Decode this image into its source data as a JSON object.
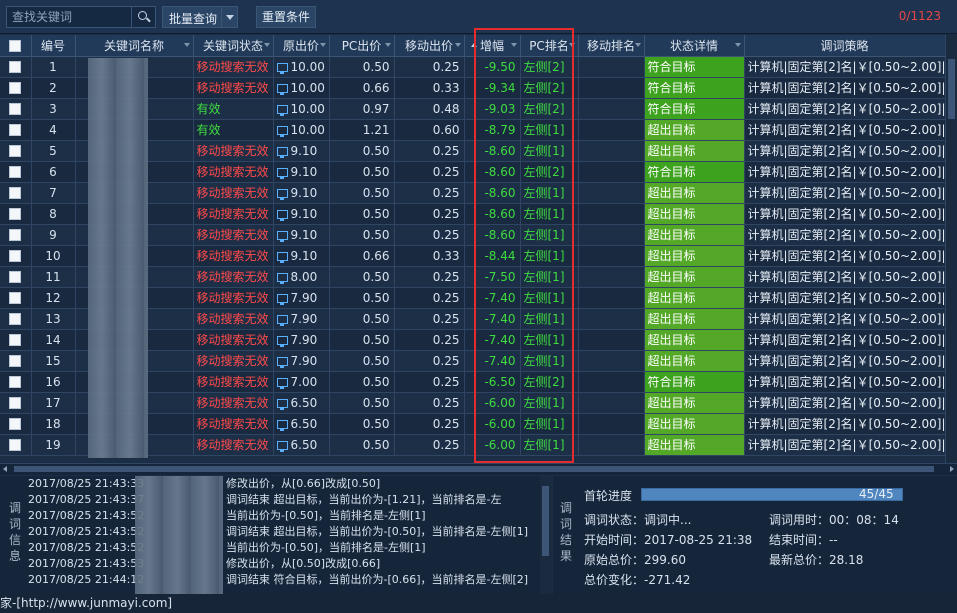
{
  "toolbar": {
    "search_placeholder": "查找关键词",
    "batch_label": "批量查询",
    "reset_label": "重置条件",
    "counter": "0/1123"
  },
  "table": {
    "headers": [
      "编号",
      "关键词名称",
      "关键词状态",
      "原出价",
      "PC出价",
      "移动出价",
      "增幅",
      "PC排名",
      "移动排名",
      "状态详情",
      "调词策略"
    ],
    "rows": [
      {
        "num": "1",
        "name": "",
        "status": "移动搜索无效",
        "orig": "10.00",
        "pc": "0.50",
        "mob": "0.25",
        "inc": "-9.50",
        "rank": "左侧[2]",
        "mrank": "",
        "detail": "符合目标",
        "strategy": "计算机|固定第[2]名|￥[0.50~2.00]|禧"
      },
      {
        "num": "2",
        "name": "",
        "status": "移动搜索无效",
        "orig": "10.00",
        "pc": "0.66",
        "mob": "0.33",
        "inc": "-9.34",
        "rank": "左侧[2]",
        "mrank": "",
        "detail": "符合目标",
        "strategy": "计算机|固定第[2]名|￥[0.50~2.00]|禧"
      },
      {
        "num": "3",
        "name": "",
        "status": "有效",
        "orig": "10.00",
        "pc": "0.97",
        "mob": "0.48",
        "inc": "-9.03",
        "rank": "左侧[2]",
        "mrank": "",
        "detail": "符合目标",
        "strategy": "计算机|固定第[2]名|￥[0.50~2.00]|禧"
      },
      {
        "num": "4",
        "name": "",
        "status": "有效",
        "orig": "10.00",
        "pc": "1.21",
        "mob": "0.60",
        "inc": "-8.79",
        "rank": "左侧[1]",
        "mrank": "",
        "detail": "超出目标",
        "strategy": "计算机|固定第[2]名|￥[0.50~2.00]|禧"
      },
      {
        "num": "5",
        "name": "",
        "status": "移动搜索无效",
        "orig": "9.10",
        "pc": "0.50",
        "mob": "0.25",
        "inc": "-8.60",
        "rank": "左侧[1]",
        "mrank": "",
        "detail": "超出目标",
        "strategy": "计算机|固定第[2]名|￥[0.50~2.00]|禧"
      },
      {
        "num": "6",
        "name": "",
        "status": "移动搜索无效",
        "orig": "9.10",
        "pc": "0.50",
        "mob": "0.25",
        "inc": "-8.60",
        "rank": "左侧[2]",
        "mrank": "",
        "detail": "符合目标",
        "strategy": "计算机|固定第[2]名|￥[0.50~2.00]|禧"
      },
      {
        "num": "7",
        "name": "",
        "status": "移动搜索无效",
        "orig": "9.10",
        "pc": "0.50",
        "mob": "0.25",
        "inc": "-8.60",
        "rank": "左侧[1]",
        "mrank": "",
        "detail": "超出目标",
        "strategy": "计算机|固定第[2]名|￥[0.50~2.00]|禧"
      },
      {
        "num": "8",
        "name": "",
        "status": "移动搜索无效",
        "orig": "9.10",
        "pc": "0.50",
        "mob": "0.25",
        "inc": "-8.60",
        "rank": "左侧[1]",
        "mrank": "",
        "detail": "超出目标",
        "strategy": "计算机|固定第[2]名|￥[0.50~2.00]|禧"
      },
      {
        "num": "9",
        "name": "",
        "status": "移动搜索无效",
        "orig": "9.10",
        "pc": "0.50",
        "mob": "0.25",
        "inc": "-8.60",
        "rank": "左侧[1]",
        "mrank": "",
        "detail": "超出目标",
        "strategy": "计算机|固定第[2]名|￥[0.50~2.00]|禧"
      },
      {
        "num": "10",
        "name": "",
        "status": "移动搜索无效",
        "orig": "9.10",
        "pc": "0.66",
        "mob": "0.33",
        "inc": "-8.44",
        "rank": "左侧[1]",
        "mrank": "",
        "detail": "超出目标",
        "strategy": "计算机|固定第[2]名|￥[0.50~2.00]|禧"
      },
      {
        "num": "11",
        "name": "",
        "status": "移动搜索无效",
        "orig": "8.00",
        "pc": "0.50",
        "mob": "0.25",
        "inc": "-7.50",
        "rank": "左侧[1]",
        "mrank": "",
        "detail": "超出目标",
        "strategy": "计算机|固定第[2]名|￥[0.50~2.00]|禧"
      },
      {
        "num": "12",
        "name": "",
        "status": "移动搜索无效",
        "orig": "7.90",
        "pc": "0.50",
        "mob": "0.25",
        "inc": "-7.40",
        "rank": "左侧[1]",
        "mrank": "",
        "detail": "超出目标",
        "strategy": "计算机|固定第[2]名|￥[0.50~2.00]|禧"
      },
      {
        "num": "13",
        "name": "",
        "status": "移动搜索无效",
        "orig": "7.90",
        "pc": "0.50",
        "mob": "0.25",
        "inc": "-7.40",
        "rank": "左侧[1]",
        "mrank": "",
        "detail": "超出目标",
        "strategy": "计算机|固定第[2]名|￥[0.50~2.00]|禧"
      },
      {
        "num": "14",
        "name": "",
        "status": "移动搜索无效",
        "orig": "7.90",
        "pc": "0.50",
        "mob": "0.25",
        "inc": "-7.40",
        "rank": "左侧[1]",
        "mrank": "",
        "detail": "超出目标",
        "strategy": "计算机|固定第[2]名|￥[0.50~2.00]|禧"
      },
      {
        "num": "15",
        "name": "",
        "status": "移动搜索无效",
        "orig": "7.90",
        "pc": "0.50",
        "mob": "0.25",
        "inc": "-7.40",
        "rank": "左侧[1]",
        "mrank": "",
        "detail": "超出目标",
        "strategy": "计算机|固定第[2]名|￥[0.50~2.00]|禧"
      },
      {
        "num": "16",
        "name": "",
        "status": "移动搜索无效",
        "orig": "7.00",
        "pc": "0.50",
        "mob": "0.25",
        "inc": "-6.50",
        "rank": "左侧[2]",
        "mrank": "",
        "detail": "符合目标",
        "strategy": "计算机|固定第[2]名|￥[0.50~2.00]|禧"
      },
      {
        "num": "17",
        "name": "",
        "status": "移动搜索无效",
        "orig": "6.50",
        "pc": "0.50",
        "mob": "0.25",
        "inc": "-6.00",
        "rank": "左侧[1]",
        "mrank": "",
        "detail": "超出目标",
        "strategy": "计算机|固定第[2]名|￥[0.50~2.00]|禧"
      },
      {
        "num": "18",
        "name": "",
        "status": "移动搜索无效",
        "orig": "6.50",
        "pc": "0.50",
        "mob": "0.25",
        "inc": "-6.00",
        "rank": "左侧[1]",
        "mrank": "",
        "detail": "超出目标",
        "strategy": "计算机|固定第[2]名|￥[0.50~2.00]|禧"
      },
      {
        "num": "19",
        "name": "",
        "status": "移动搜索无效",
        "orig": "6.50",
        "pc": "0.50",
        "mob": "0.25",
        "inc": "-6.00",
        "rank": "左侧[1]",
        "mrank": "",
        "detail": "超出目标",
        "strategy": "计算机|固定第[2]名|￥[0.50~2.00]|禧"
      }
    ]
  },
  "log": {
    "side_label": "调词信息",
    "lines": [
      {
        "ts": "2017/08/25 21:43:33",
        "msg": "修改出价，从[0.66]改成[0.50]"
      },
      {
        "ts": "2017/08/25 21:43:37",
        "msg": "调词结束 超出目标，当前出价为-[1.21]，当前排名是-左"
      },
      {
        "ts": "2017/08/25 21:43:52",
        "msg": "当前出价为-[0.50]，当前排名是-左侧[1]"
      },
      {
        "ts": "2017/08/25 21:43:52",
        "msg": "调词结束 超出目标，当前出价为-[0.50]，当前排名是-左侧[1]"
      },
      {
        "ts": "2017/08/25 21:43:52",
        "msg": "当前出价为-[0.50]，当前排名是-左侧[1]"
      },
      {
        "ts": "2017/08/25 21:43:53",
        "msg": "修改出价，从[0.50]改成[0.66]"
      },
      {
        "ts": "2017/08/25 21:44:12",
        "msg": "调词结束 符合目标，当前出价为-[0.66]，当前排名是-左侧[2]"
      }
    ]
  },
  "result": {
    "side_label": "调词结果",
    "progress_label": "首轮进度",
    "progress_text": "45/45",
    "progress_value": 1.0,
    "status_label": "调词状态",
    "status_value": "：调词中...",
    "elapsed_label": "调词用时",
    "elapsed_value": "：00：08：14",
    "start_label": "开始时间",
    "start_value": "：2017-08-25 21:38",
    "end_label": "结束时间",
    "end_value": "：--",
    "orig_total_label": "原始总价",
    "orig_total_value": "：299.60",
    "new_total_label": "最新总价",
    "new_total_value": "：28.18",
    "change_label": "总价变化",
    "change_value": "：-271.42"
  },
  "statusbar": {
    "text": "家-[http://www.junmayi.com]"
  },
  "colors": {
    "invalid": "#ff4a4a",
    "valid": "#3fdc3f",
    "highlight": "#e52b2b",
    "status_ok": "#3da21d",
    "status_over": "#53a927"
  }
}
